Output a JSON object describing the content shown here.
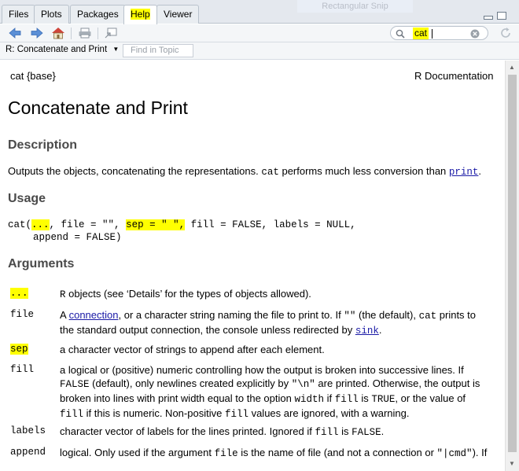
{
  "tabs": [
    "Files",
    "Plots",
    "Packages",
    "Help",
    "Viewer"
  ],
  "snip_label": "Rectangular Snip",
  "search": {
    "value": "cat"
  },
  "topic": {
    "selected": "R: Concatenate and Print",
    "find_placeholder": "Find in Topic"
  },
  "doc": {
    "package_ref": "cat {base}",
    "r_doc": "R Documentation",
    "title": "Concatenate and Print",
    "description_heading": "Description",
    "description_text": "Outputs the objects, concatenating the representations.",
    "description_code": "cat",
    "description_text2": "performs much less conversion than",
    "description_link": "print",
    "usage_heading": "Usage",
    "usage_p1": "cat(",
    "usage_dots": "...",
    "usage_p2": ", file = \"\",",
    "usage_sep": "sep = \" \",",
    "usage_p3": "fill = FALSE, labels = NULL,",
    "usage_line2": "append = FALSE)",
    "arguments_heading": "Arguments",
    "args": {
      "dots_name": "...",
      "dots_code": "R",
      "dots_desc": "objects (see ‘Details’ for the types of objects allowed).",
      "file_name": "file",
      "file_a": "A",
      "file_link": "connection",
      "file_b": ", or a character string naming the file to print to. If",
      "file_code1": "\"\"",
      "file_c": "(the default),",
      "file_code2": "cat",
      "file_d": "prints to",
      "file_line2": "the standard output connection, the console unless redirected by",
      "file_link2": "sink",
      "sep_name": "sep",
      "sep_desc": "a character vector of strings to append after each element.",
      "fill_name": "fill",
      "fill_l1": "a logical or (positive) numeric controlling how the output is broken into successive lines. If",
      "fill_code1": "FALSE",
      "fill_l2a": "(default), only newlines created explicitly by",
      "fill_code2": "\"\\n\"",
      "fill_l2b": "are printed. Otherwise, the output is",
      "fill_l3a": "broken into lines with print width equal to the option",
      "fill_code3": "width",
      "fill_l3b": "if",
      "fill_code4": "fill",
      "fill_l3c": "is",
      "fill_code5": "TRUE",
      "fill_l3d": ", or the value of",
      "fill_code6": "fill",
      "fill_l4a": "if this is numeric. Non-positive",
      "fill_code7": "fill",
      "fill_l4b": "values are ignored, with a warning.",
      "labels_name": "labels",
      "labels_a": "character vector of labels for the lines printed. Ignored if",
      "labels_code1": "fill",
      "labels_b": "is",
      "labels_code2": "FALSE",
      "append_name": "append",
      "append_a": "logical. Only used if the argument",
      "append_code1": "file",
      "append_b": "is the name of file (and not a connection or",
      "append_code2": "\"|cmd\"",
      "append_c": "). If"
    }
  },
  "colors": {
    "highlight": "#ffff00",
    "link": "#1a1aa6",
    "heading": "#4a4a4a"
  }
}
